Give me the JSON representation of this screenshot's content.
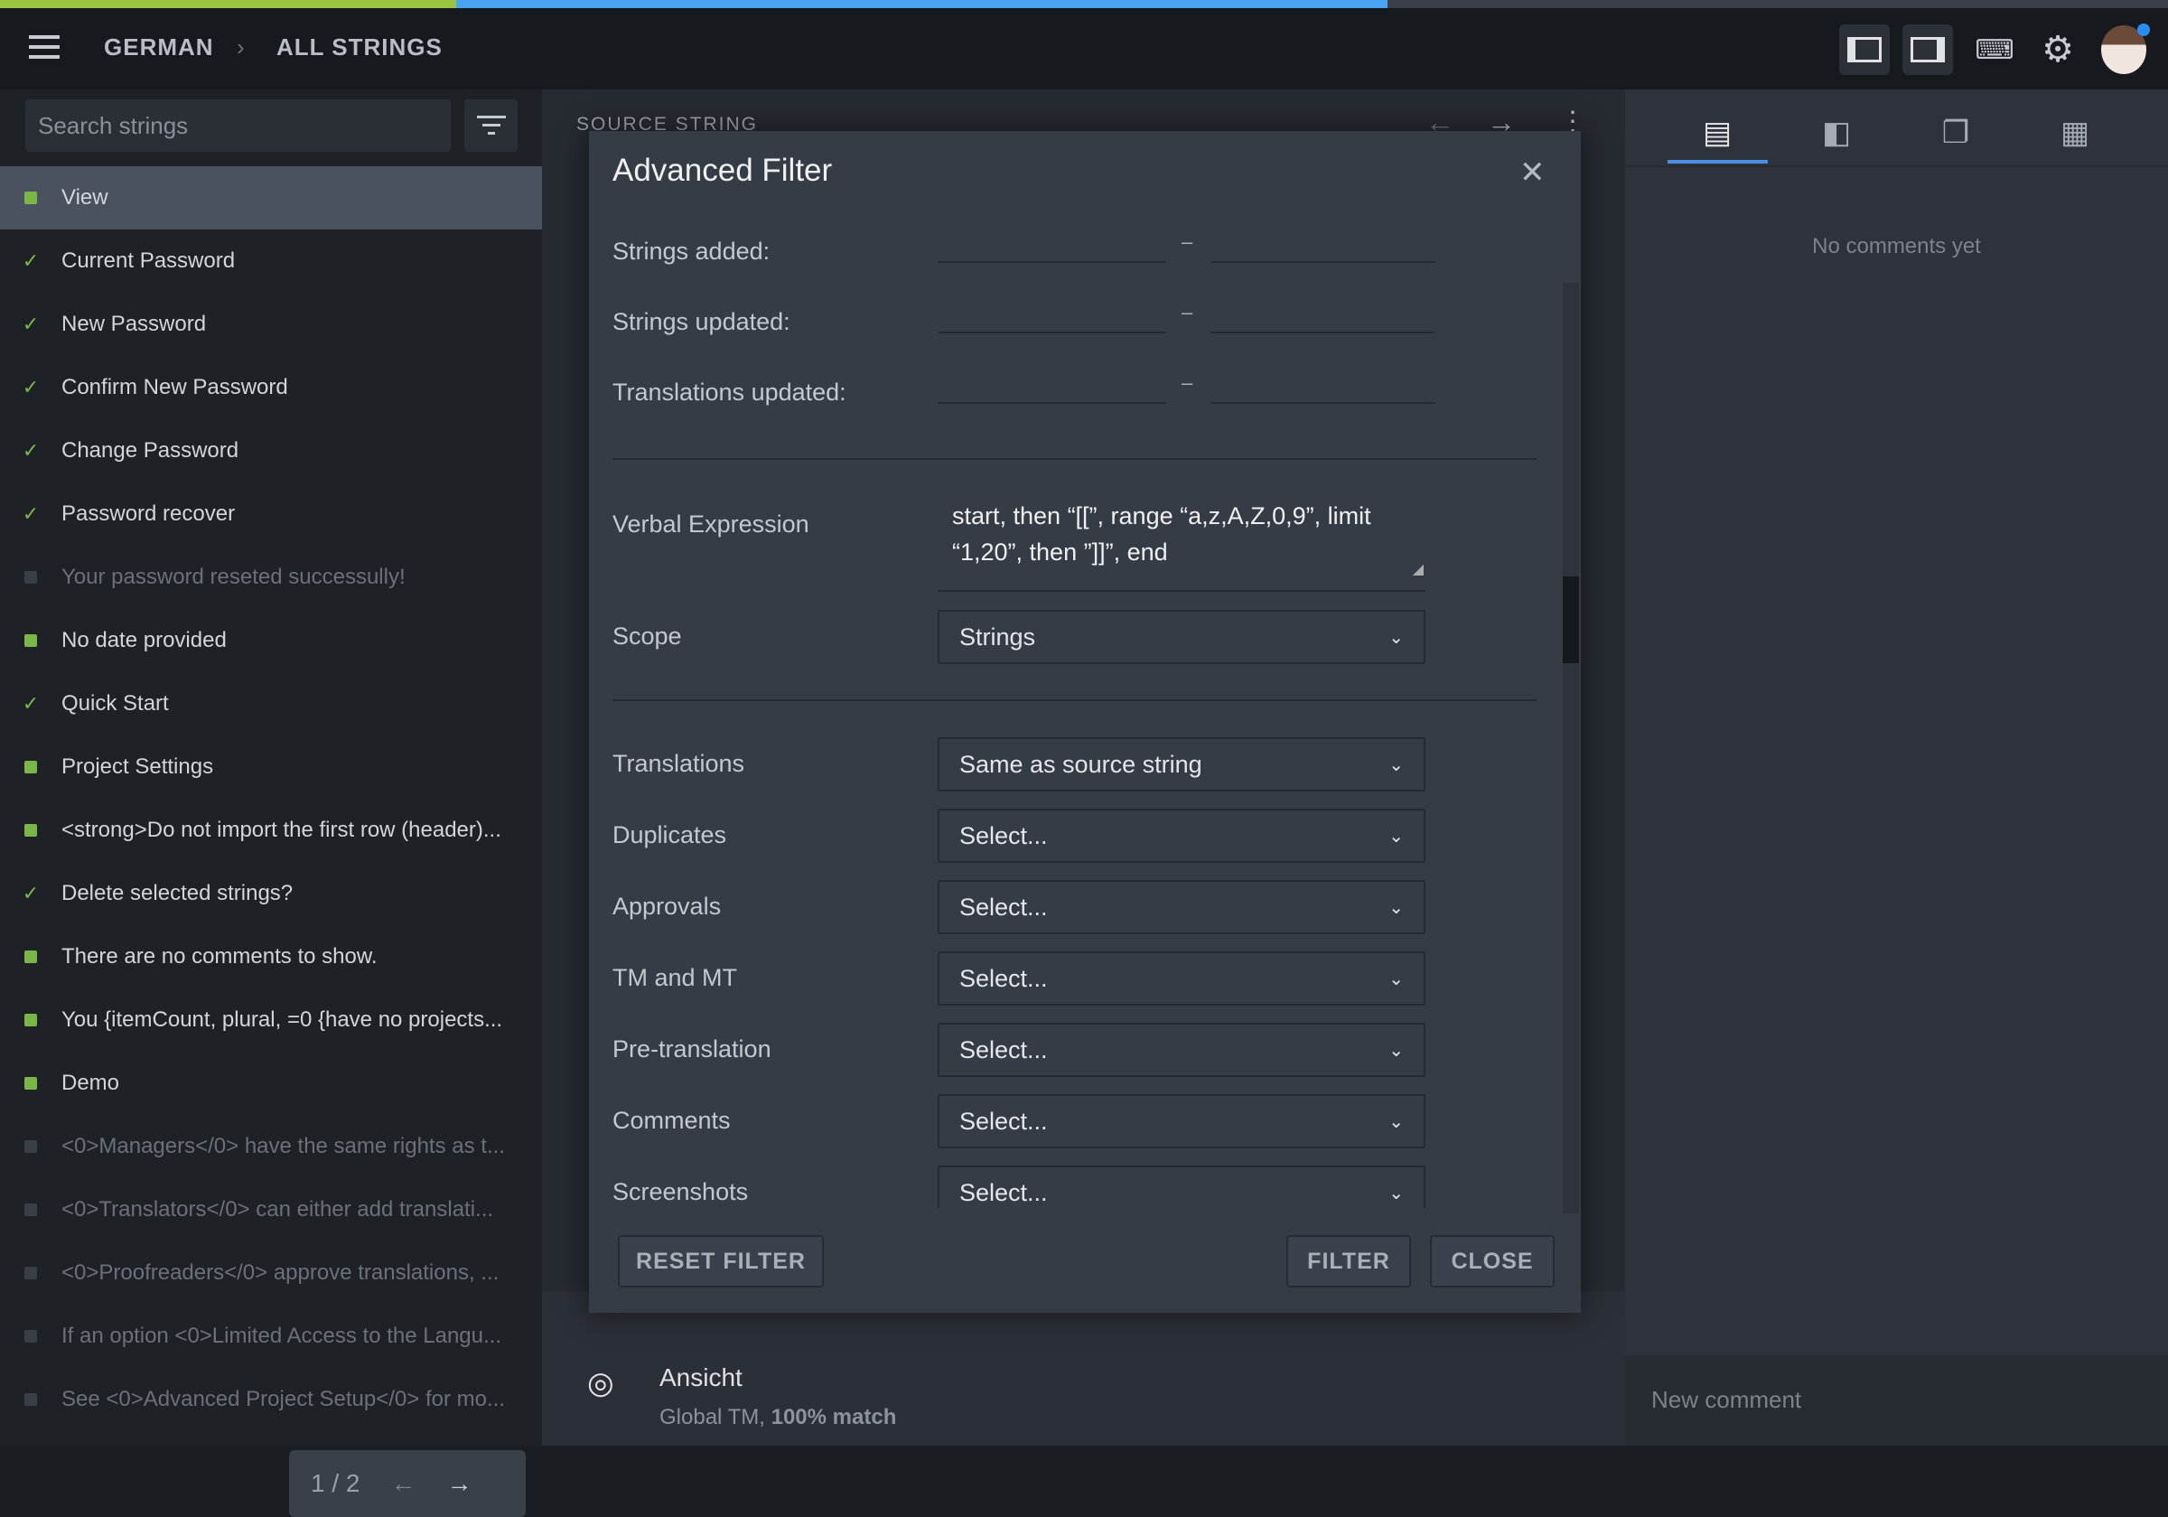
{
  "progress": {
    "approved_percent": 21,
    "translated_percent": 43,
    "colors": {
      "approved": "#9bc53d",
      "translated": "#4aa3f0"
    }
  },
  "header": {
    "breadcrumb": [
      "GERMAN",
      "ALL STRINGS"
    ],
    "icons": [
      "menu-icon",
      "chevron-right-icon",
      "left-panel-icon",
      "right-panel-icon",
      "keyboard-icon",
      "gear-icon",
      "avatar"
    ]
  },
  "sidebar": {
    "search_placeholder": "Search strings",
    "items": [
      {
        "label": "View",
        "status": "untranslated-green",
        "selected": true
      },
      {
        "label": "Current Password",
        "status": "approved"
      },
      {
        "label": "New Password",
        "status": "approved"
      },
      {
        "label": "Confirm New Password",
        "status": "approved"
      },
      {
        "label": "Change Password",
        "status": "approved"
      },
      {
        "label": "Password recover",
        "status": "approved"
      },
      {
        "label": "Your password reseted successully!",
        "status": "untranslated"
      },
      {
        "label": "No date provided",
        "status": "translated"
      },
      {
        "label": "Quick Start",
        "status": "approved"
      },
      {
        "label": "Project Settings",
        "status": "translated"
      },
      {
        "label": "<strong>Do not import the first row (header)...",
        "status": "translated"
      },
      {
        "label": "Delete selected strings?",
        "status": "approved"
      },
      {
        "label": "There are no comments to show.",
        "status": "translated"
      },
      {
        "label": "You {itemCount, plural, =0 {have no projects...",
        "status": "translated"
      },
      {
        "label": "Demo",
        "status": "translated"
      },
      {
        "label": "<0>Managers</0> have the same rights as t...",
        "status": "untranslated"
      },
      {
        "label": "<0>Translators</0> can either add translati...",
        "status": "untranslated"
      },
      {
        "label": "<0>Proofreaders</0> approve translations, ...",
        "status": "untranslated"
      },
      {
        "label": "If an option <0>Limited Access to the Langu...",
        "status": "untranslated"
      },
      {
        "label": "See <0>Advanced Project Setup</0> for mo...",
        "status": "untranslated"
      }
    ],
    "pager": {
      "text": "1 / 2"
    }
  },
  "middle": {
    "source_label": "SOURCE STRING",
    "suggestion": {
      "text": "Ansicht",
      "meta_prefix": "Global TM, ",
      "meta_match": "100% match"
    }
  },
  "right": {
    "empty_text": "No comments yet",
    "new_comment_placeholder": "New comment",
    "tabs": [
      "comments-icon",
      "details-icon",
      "glossary-icon",
      "apps-icon"
    ]
  },
  "dialog": {
    "title": "Advanced Filter",
    "date_rows": [
      {
        "label": "Strings added:"
      },
      {
        "label": "Strings updated:"
      },
      {
        "label": "Translations updated:"
      }
    ],
    "dash": "–",
    "verbal_label": "Verbal Expression",
    "verbal_value": "start, then “[[”, range “a,z,A,Z,0,9”, limit “1,20”, then ”]]”, end",
    "scope": {
      "label": "Scope",
      "value": "Strings"
    },
    "selects": [
      {
        "label": "Translations",
        "value": "Same as source string"
      },
      {
        "label": "Duplicates",
        "value": "Select..."
      },
      {
        "label": "Approvals",
        "value": "Select..."
      },
      {
        "label": "TM and MT",
        "value": "Select..."
      },
      {
        "label": "Pre-translation",
        "value": "Select..."
      },
      {
        "label": "Comments",
        "value": "Select..."
      },
      {
        "label": "Screenshots",
        "value": "Select..."
      }
    ],
    "buttons": {
      "reset": "RESET FILTER",
      "filter": "FILTER",
      "close": "CLOSE"
    }
  }
}
